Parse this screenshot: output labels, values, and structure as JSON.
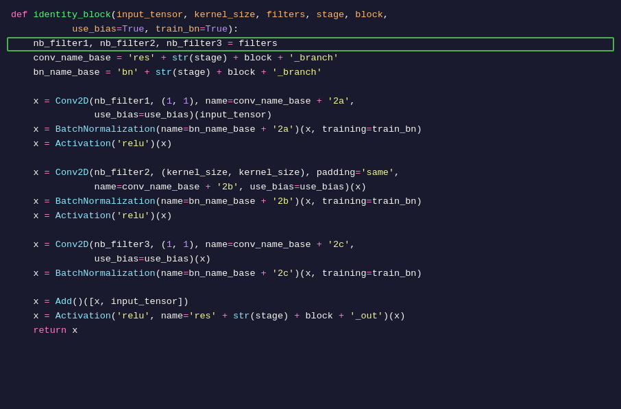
{
  "editor": {
    "background": "#1a1a2e",
    "highlight_border": "#4caf50",
    "lines": [
      {
        "id": 1,
        "highlighted": false
      },
      {
        "id": 2,
        "highlighted": false
      },
      {
        "id": 3,
        "highlighted": true
      },
      {
        "id": 4,
        "highlighted": false
      },
      {
        "id": 5,
        "highlighted": false
      },
      {
        "id": 6,
        "highlighted": false
      },
      {
        "id": 7,
        "highlighted": false
      },
      {
        "id": 8,
        "highlighted": false
      },
      {
        "id": 9,
        "highlighted": false
      },
      {
        "id": 10,
        "highlighted": false
      }
    ]
  }
}
